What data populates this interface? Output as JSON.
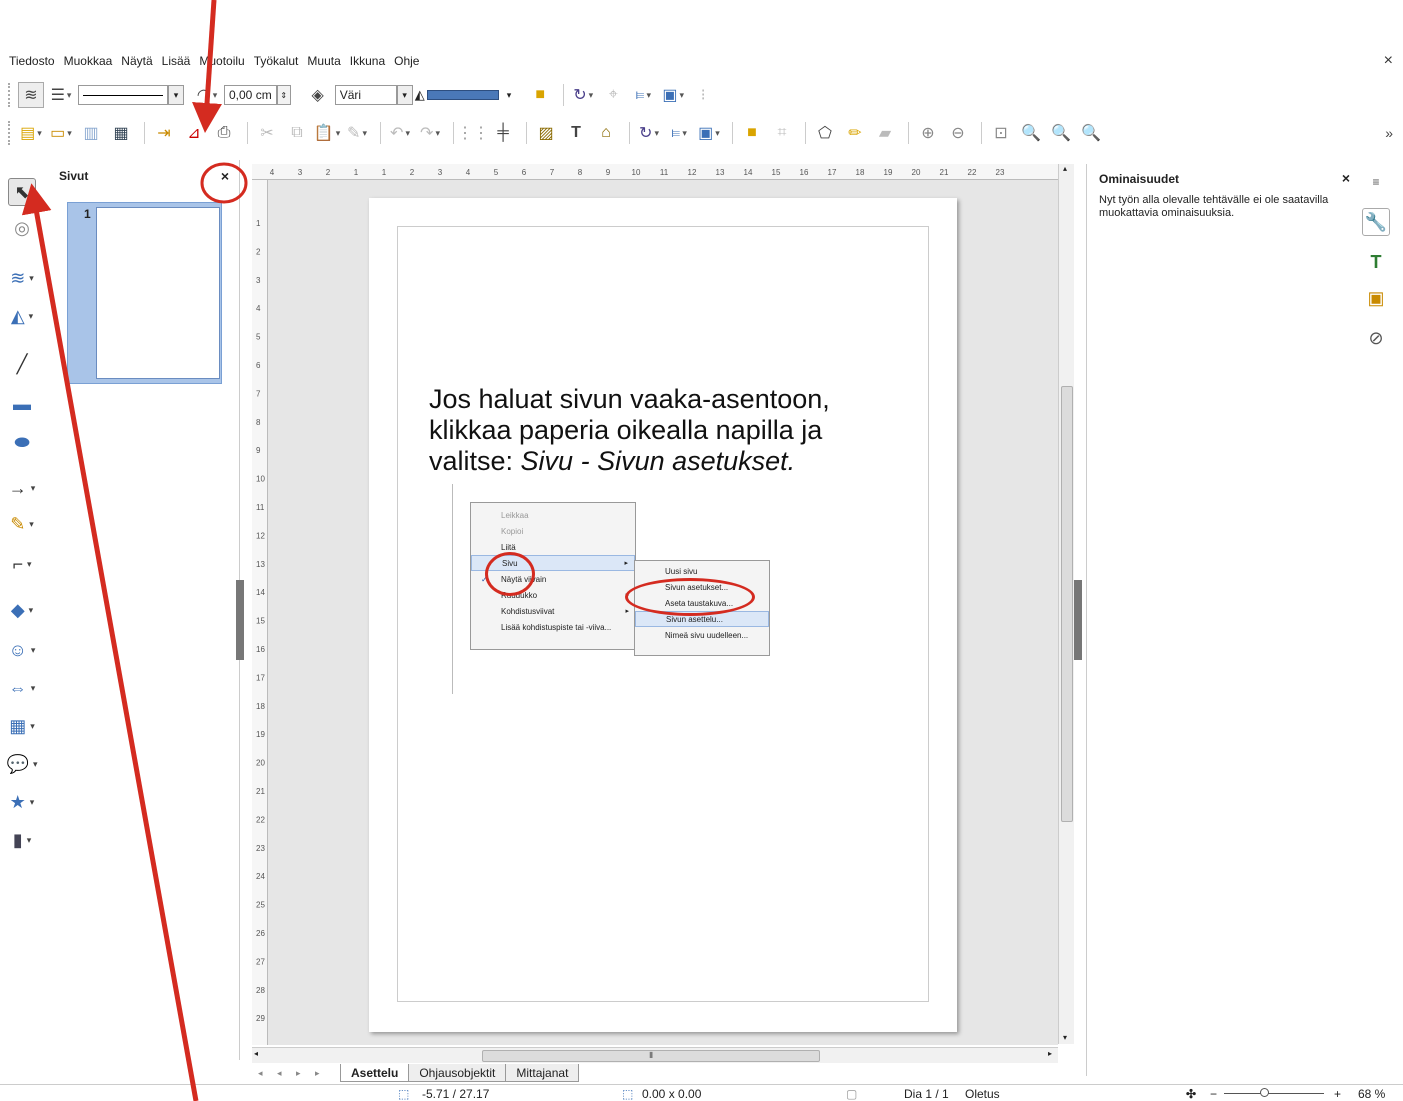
{
  "menubar": {
    "items": [
      "Tiedosto",
      "Muokkaa",
      "Näytä",
      "Lisää",
      "Muotoilu",
      "Työkalut",
      "Muuta",
      "Ikkuna",
      "Ohje"
    ],
    "close": "×"
  },
  "toolbar1": {
    "line_width_value": "0,00 cm",
    "area_style_value": "Väri",
    "fill_color": "#4a78b8"
  },
  "toolbar2": {
    "more": "»"
  },
  "slide_pane": {
    "title": "Sivut",
    "close": "×",
    "slide_number": "1"
  },
  "ruler": {
    "h_ticks": [
      "4",
      "3",
      "2",
      "1",
      "1",
      "2",
      "3",
      "4",
      "5",
      "6",
      "7",
      "8",
      "9",
      "10",
      "11",
      "12",
      "13",
      "14",
      "15",
      "16",
      "17",
      "18",
      "19",
      "20",
      "21",
      "22",
      "23"
    ],
    "v_ticks": [
      "1",
      "2",
      "3",
      "4",
      "5",
      "6",
      "7",
      "8",
      "9",
      "10",
      "11",
      "12",
      "13",
      "14",
      "15",
      "16",
      "17",
      "18",
      "19",
      "20",
      "21",
      "22",
      "23",
      "24",
      "25",
      "26",
      "27",
      "28",
      "29"
    ]
  },
  "slide": {
    "text_line1": "Jos haluat sivun vaaka-asentoon,",
    "text_line2": "klikkaa paperia oikealla napilla ja",
    "text_line3_prefix": "valitse: ",
    "text_line3_italic": "Sivu - Sivun asetukset."
  },
  "context_menu": {
    "items": [
      {
        "label": "Leikkaa",
        "state": "disabled"
      },
      {
        "label": "Kopioi",
        "state": "disabled"
      },
      {
        "label": "Liitä",
        "state": "normal"
      },
      {
        "label": "Sivu",
        "state": "highlighted"
      },
      {
        "label": "Näytä viivain",
        "state": "checked"
      },
      {
        "label": "Ruudukko",
        "state": "normal"
      },
      {
        "label": "Kohdistusviivat",
        "state": "normal"
      },
      {
        "label": "Lisää kohdistuspiste tai -viiva...",
        "state": "normal"
      }
    ],
    "submenu": [
      {
        "label": "Uusi sivu"
      },
      {
        "label": "Sivun asetukset..."
      },
      {
        "label": "Aseta taustakuva..."
      },
      {
        "label": "Sivun asettelu..."
      },
      {
        "label": "Nimeä sivu uudelleen..."
      }
    ]
  },
  "tabs": {
    "nav": "◂ ◂ ▸ ▸",
    "items": [
      "Asettelu",
      "Ohjausobjektit",
      "Mittajanat"
    ],
    "active": "Asettelu"
  },
  "sidebar": {
    "title": "Ominaisuudet",
    "close": "×",
    "message": "Nyt työn alla olevalle tehtävälle ei ole saatavilla muokattavia ominaisuuksia."
  },
  "statusbar": {
    "position": "-5.71 / 27.17",
    "size": "0.00 x 0.00",
    "slide_info": "Dia 1 / 1",
    "master": "Oletus",
    "zoom": "68 %",
    "zoom_fraction": 0.36
  },
  "colors": {
    "annotation": "#d42b20",
    "slide_thumb_bg": "#a9c4e8"
  }
}
